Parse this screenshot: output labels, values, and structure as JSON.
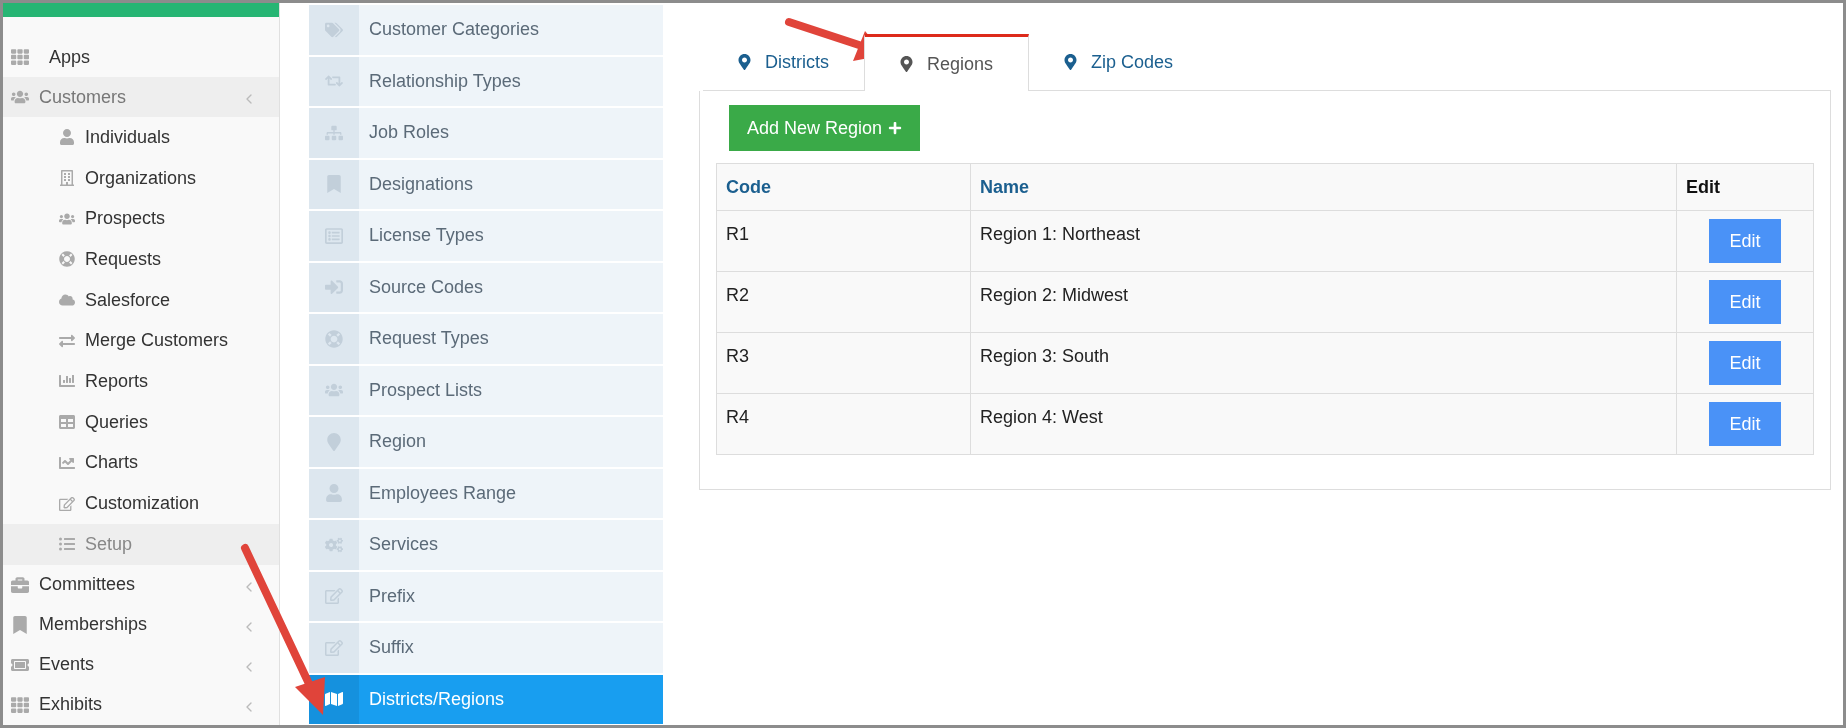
{
  "sidebar": {
    "items": [
      {
        "label": "Apps",
        "has_submenu": false,
        "active": false
      },
      {
        "label": "Customers",
        "has_submenu": true,
        "active": true,
        "children": [
          {
            "label": "Individuals",
            "selected": false
          },
          {
            "label": "Organizations",
            "selected": false
          },
          {
            "label": "Prospects",
            "selected": false
          },
          {
            "label": "Requests",
            "selected": false
          },
          {
            "label": "Salesforce",
            "selected": false
          },
          {
            "label": "Merge Customers",
            "selected": false
          },
          {
            "label": "Reports",
            "selected": false
          },
          {
            "label": "Queries",
            "selected": false
          },
          {
            "label": "Charts",
            "selected": false
          },
          {
            "label": "Customization",
            "selected": false
          },
          {
            "label": "Setup",
            "selected": true
          }
        ]
      },
      {
        "label": "Committees",
        "has_submenu": true,
        "active": false
      },
      {
        "label": "Memberships",
        "has_submenu": true,
        "active": false
      },
      {
        "label": "Events",
        "has_submenu": true,
        "active": false
      },
      {
        "label": "Exhibits",
        "has_submenu": true,
        "active": false
      }
    ]
  },
  "setup_menu": {
    "items": [
      {
        "label": "Customer Categories",
        "selected": false
      },
      {
        "label": "Relationship Types",
        "selected": false
      },
      {
        "label": "Job Roles",
        "selected": false
      },
      {
        "label": "Designations",
        "selected": false
      },
      {
        "label": "License Types",
        "selected": false
      },
      {
        "label": "Source Codes",
        "selected": false
      },
      {
        "label": "Request Types",
        "selected": false
      },
      {
        "label": "Prospect Lists",
        "selected": false
      },
      {
        "label": "Region",
        "selected": false
      },
      {
        "label": "Employees Range",
        "selected": false
      },
      {
        "label": "Services",
        "selected": false
      },
      {
        "label": "Prefix",
        "selected": false
      },
      {
        "label": "Suffix",
        "selected": false
      },
      {
        "label": "Districts/Regions",
        "selected": true
      }
    ]
  },
  "tabs": [
    {
      "label": "Districts",
      "selected": false
    },
    {
      "label": "Regions",
      "selected": true
    },
    {
      "label": "Zip Codes",
      "selected": false
    }
  ],
  "add_button": {
    "label": "Add New Region"
  },
  "table": {
    "columns": [
      "Code",
      "Name",
      "Edit"
    ],
    "rows": [
      {
        "code": "R1",
        "name": "Region 1: Northeast",
        "action": "Edit"
      },
      {
        "code": "R2",
        "name": "Region 2: Midwest",
        "action": "Edit"
      },
      {
        "code": "R3",
        "name": "Region 3: South",
        "action": "Edit"
      },
      {
        "code": "R4",
        "name": "Region 4: West",
        "action": "Edit"
      }
    ]
  }
}
